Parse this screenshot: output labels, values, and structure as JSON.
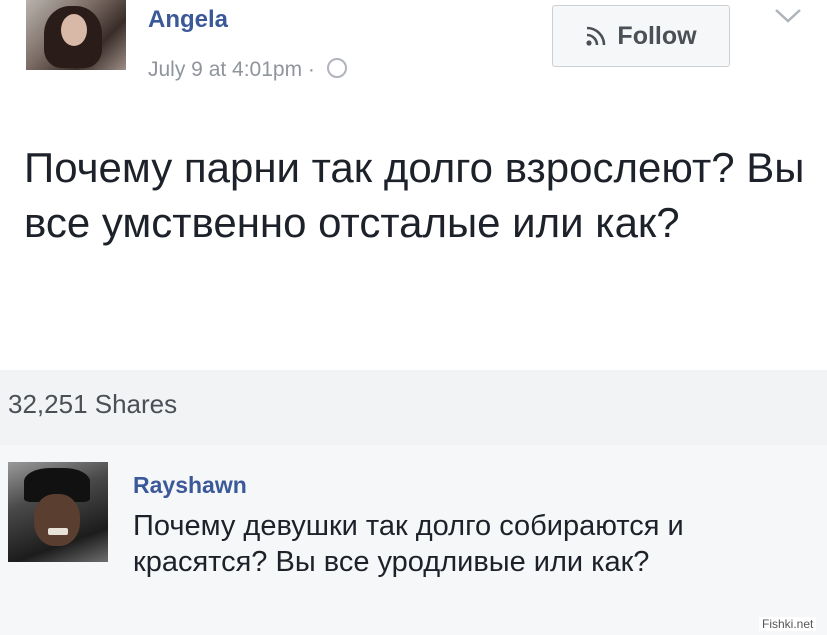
{
  "post": {
    "author": "Angela",
    "timestamp": "July 9 at 4:01pm ·",
    "follow_label": "Follow",
    "text": "Почему парни так долго взрослеют? Вы все умственно отсталые или как?"
  },
  "shares": {
    "label": "32,251 Shares"
  },
  "comment": {
    "author": "Rayshawn",
    "text": "Почему девушки так долго собираются и красятся? Вы все уродливые или как?"
  },
  "watermark": "Fishki.net",
  "icons": {
    "follow": "rss-icon",
    "privacy": "globe-icon",
    "menu": "chevron-down-icon"
  },
  "colors": {
    "name_link": "#3b5998",
    "meta_gray": "#90949c",
    "body_text": "#1d2129"
  }
}
